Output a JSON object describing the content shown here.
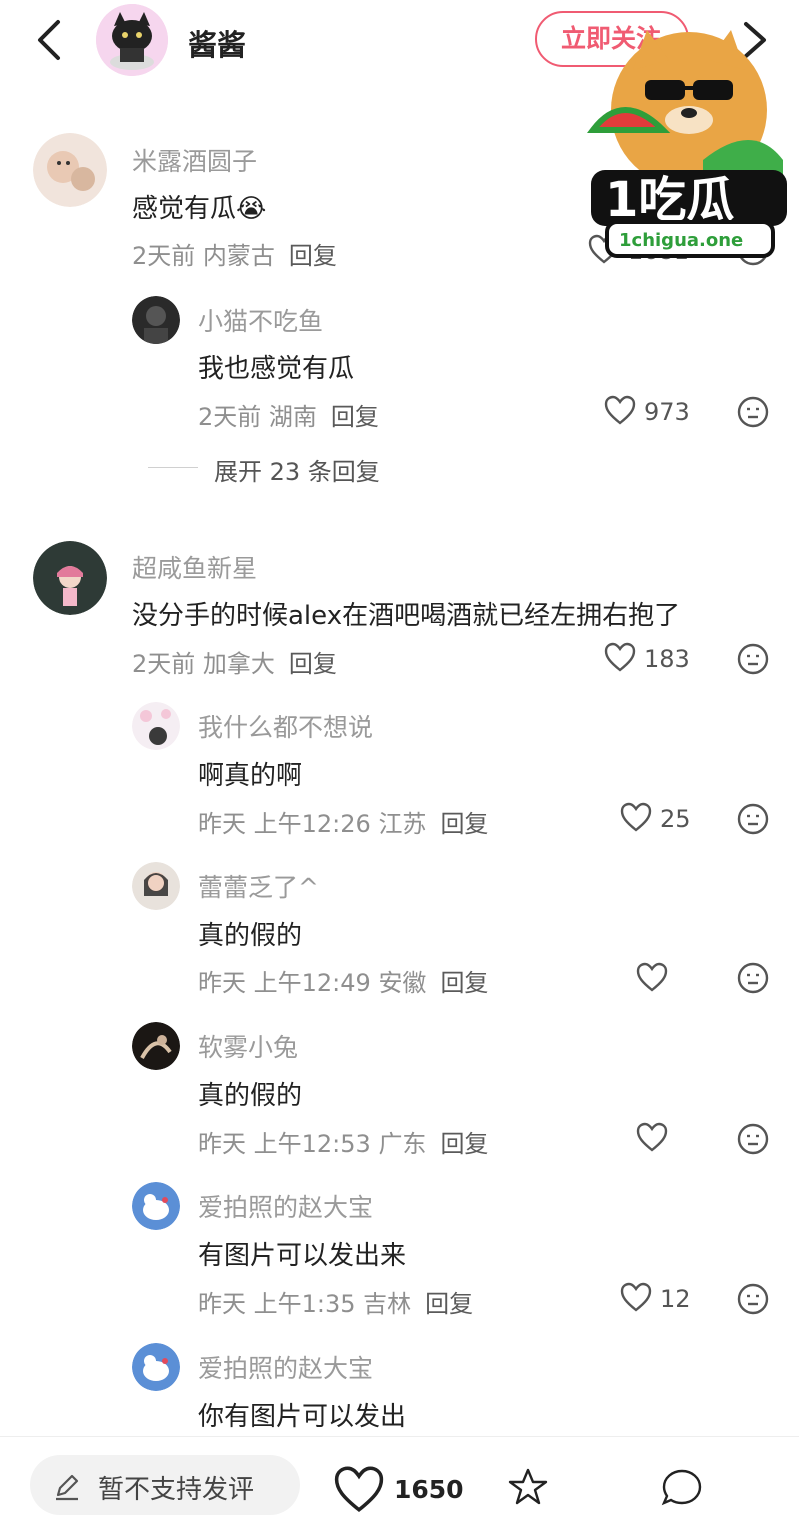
{
  "header": {
    "author_name": "酱酱",
    "follow_label": "立即关注"
  },
  "comments": [
    {
      "user": "米露酒圆子",
      "text": "感觉有瓜",
      "emoji": "😭",
      "time": "2天前",
      "region": "内蒙古",
      "reply": "回复",
      "likes": "1681"
    },
    {
      "user": "小猫不吃鱼",
      "text": "我也感觉有瓜",
      "time": "2天前",
      "region": "湖南",
      "reply": "回复",
      "likes": "973"
    },
    {
      "user": "超咸鱼新星",
      "text": "没分手的时候alex在酒吧喝酒就已经左拥右抱了",
      "time": "2天前",
      "region": "加拿大",
      "reply": "回复",
      "likes": "183"
    },
    {
      "user": "我什么都不想说",
      "text": "啊真的啊",
      "time": "昨天 上午12:26",
      "region": "江苏",
      "reply": "回复",
      "likes": "25"
    },
    {
      "user": "蕾蕾乏了^",
      "text": "真的假的",
      "time": "昨天 上午12:49",
      "region": "安徽",
      "reply": "回复",
      "likes": ""
    },
    {
      "user": "软雾小兔",
      "text": "真的假的",
      "time": "昨天 上午12:53",
      "region": "广东",
      "reply": "回复",
      "likes": ""
    },
    {
      "user": "爱拍照的赵大宝",
      "text": "有图片可以发出来",
      "time": "昨天 上午1:35",
      "region": "吉林",
      "reply": "回复",
      "likes": "12"
    },
    {
      "user": "爱拍照的赵大宝",
      "text": "你有图片可以发出",
      "time": "",
      "region": "",
      "reply": "",
      "likes": ""
    }
  ],
  "expand_replies": "展开 23 条回复",
  "bottom": {
    "comment_placeholder": "暂不支持发评",
    "like_count": "1650"
  },
  "watermark": {
    "logo_text": "1吃瓜",
    "url_text": "1chigua.one"
  },
  "colors": {
    "accent": "#f05b72",
    "watermark_green": "#2e9e3a"
  },
  "icons": [
    "back-arrow-icon",
    "share-icon",
    "heart-icon",
    "neutral-face-icon",
    "pen-icon",
    "star-icon",
    "comment-icon"
  ]
}
